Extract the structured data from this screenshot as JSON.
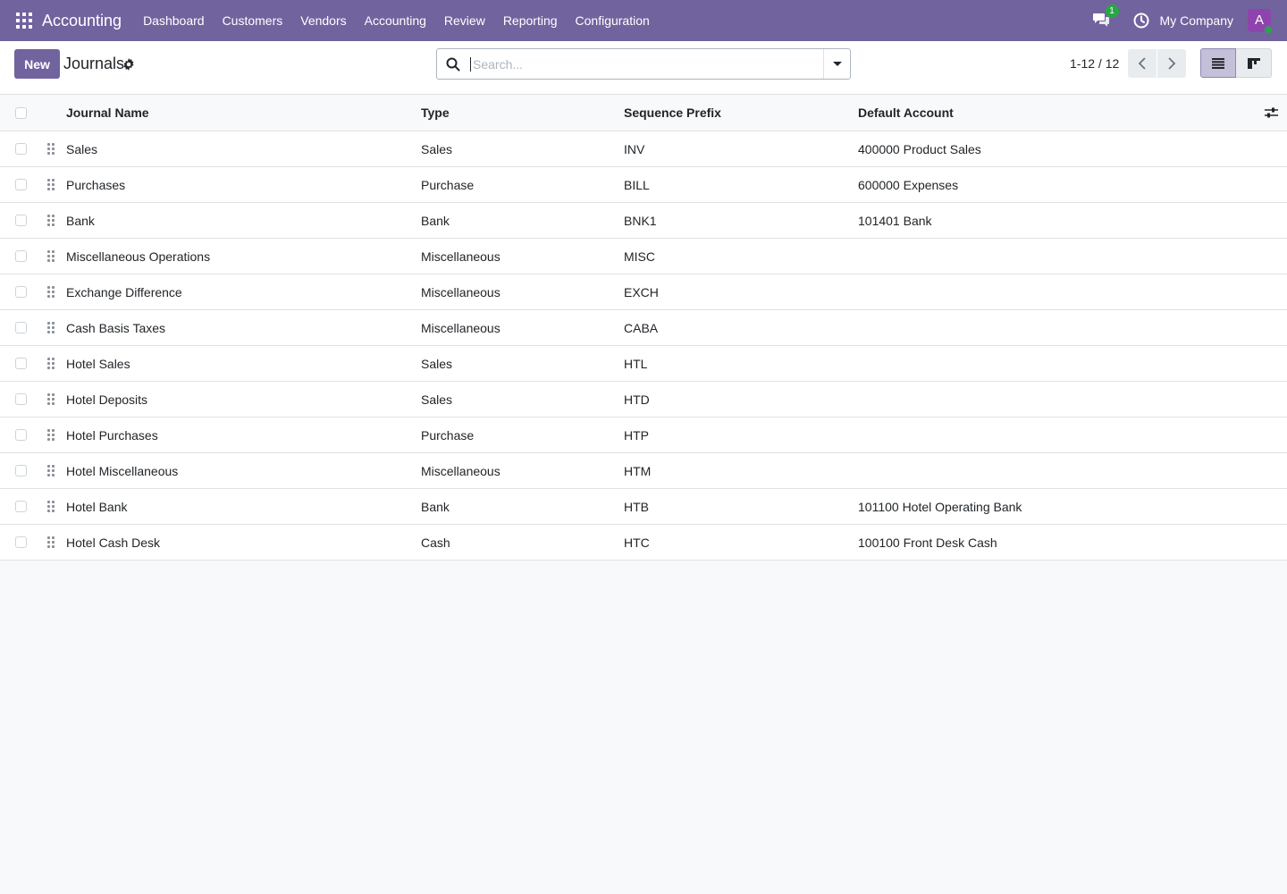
{
  "navbar": {
    "brand": "Accounting",
    "menu": [
      "Dashboard",
      "Customers",
      "Vendors",
      "Accounting",
      "Review",
      "Reporting",
      "Configuration"
    ],
    "chat_badge": "1",
    "company": "My Company",
    "avatar_letter": "A",
    "bg_color": "#71639e"
  },
  "control_panel": {
    "new_label": "New",
    "title": "Journals",
    "search_placeholder": "Search...",
    "pager": "1-12 / 12"
  },
  "table": {
    "headers": [
      "Journal Name",
      "Type",
      "Sequence Prefix",
      "Default Account"
    ],
    "rows": [
      {
        "name": "Sales",
        "type": "Sales",
        "prefix": "INV",
        "account": "400000 Product Sales"
      },
      {
        "name": "Purchases",
        "type": "Purchase",
        "prefix": "BILL",
        "account": "600000 Expenses"
      },
      {
        "name": "Bank",
        "type": "Bank",
        "prefix": "BNK1",
        "account": "101401 Bank"
      },
      {
        "name": "Miscellaneous Operations",
        "type": "Miscellaneous",
        "prefix": "MISC",
        "account": ""
      },
      {
        "name": "Exchange Difference",
        "type": "Miscellaneous",
        "prefix": "EXCH",
        "account": ""
      },
      {
        "name": "Cash Basis Taxes",
        "type": "Miscellaneous",
        "prefix": "CABA",
        "account": ""
      },
      {
        "name": "Hotel Sales",
        "type": "Sales",
        "prefix": "HTL",
        "account": ""
      },
      {
        "name": "Hotel Deposits",
        "type": "Sales",
        "prefix": "HTD",
        "account": ""
      },
      {
        "name": "Hotel Purchases",
        "type": "Purchase",
        "prefix": "HTP",
        "account": ""
      },
      {
        "name": "Hotel Miscellaneous",
        "type": "Miscellaneous",
        "prefix": "HTM",
        "account": ""
      },
      {
        "name": "Hotel Bank",
        "type": "Bank",
        "prefix": "HTB",
        "account": "101100 Hotel Operating Bank"
      },
      {
        "name": "Hotel Cash Desk",
        "type": "Cash",
        "prefix": "HTC",
        "account": "100100 Front Desk Cash"
      }
    ]
  }
}
